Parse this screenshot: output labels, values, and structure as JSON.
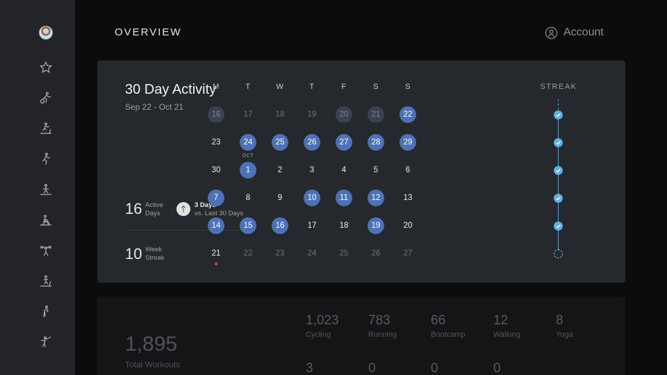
{
  "header": {
    "title": "OVERVIEW",
    "account_label": "Account"
  },
  "sidebar": {
    "items": [
      {
        "name": "avatar"
      },
      {
        "name": "star-icon"
      },
      {
        "name": "cycling-icon"
      },
      {
        "name": "treadmill-icon"
      },
      {
        "name": "running-icon"
      },
      {
        "name": "bootcamp-icon"
      },
      {
        "name": "rowing-icon"
      },
      {
        "name": "strength-icon"
      },
      {
        "name": "tread-bootcamp-icon"
      },
      {
        "name": "stretching-icon"
      },
      {
        "name": "yoga-icon"
      }
    ]
  },
  "activity": {
    "title": "30 Day Activity",
    "range": "Sep 22 - Oct 21",
    "active_days_value": "16",
    "active_days_label_1": "Active",
    "active_days_label_2": "Days",
    "trend_title": "3 Days",
    "trend_sub": "vs. Last 30 Days",
    "week_streak_value": "10",
    "week_streak_label_1": "Week",
    "week_streak_label_2": "Streak"
  },
  "calendar": {
    "day_headers": [
      "M",
      "T",
      "W",
      "T",
      "F",
      "S",
      "S"
    ],
    "streak_header": "STREAK",
    "month_tag": "OCT",
    "weeks": [
      [
        {
          "d": "16",
          "a": true,
          "m": true
        },
        {
          "d": "17",
          "a": false,
          "m": true
        },
        {
          "d": "18",
          "a": false,
          "m": true
        },
        {
          "d": "19",
          "a": false,
          "m": true
        },
        {
          "d": "20",
          "a": true,
          "m": true
        },
        {
          "d": "21",
          "a": true,
          "m": true
        },
        {
          "d": "22",
          "a": true,
          "m": false
        }
      ],
      [
        {
          "d": "23",
          "a": false,
          "m": false
        },
        {
          "d": "24",
          "a": true,
          "m": false
        },
        {
          "d": "25",
          "a": true,
          "m": false
        },
        {
          "d": "26",
          "a": true,
          "m": false
        },
        {
          "d": "27",
          "a": true,
          "m": false
        },
        {
          "d": "28",
          "a": true,
          "m": false
        },
        {
          "d": "29",
          "a": true,
          "m": false
        }
      ],
      [
        {
          "d": "30",
          "a": false,
          "m": false
        },
        {
          "d": "1",
          "a": true,
          "m": false
        },
        {
          "d": "2",
          "a": false,
          "m": false
        },
        {
          "d": "3",
          "a": false,
          "m": false
        },
        {
          "d": "4",
          "a": false,
          "m": false
        },
        {
          "d": "5",
          "a": false,
          "m": false
        },
        {
          "d": "6",
          "a": false,
          "m": false
        }
      ],
      [
        {
          "d": "7",
          "a": true,
          "m": false
        },
        {
          "d": "8",
          "a": false,
          "m": false
        },
        {
          "d": "9",
          "a": false,
          "m": false
        },
        {
          "d": "10",
          "a": true,
          "m": false
        },
        {
          "d": "11",
          "a": true,
          "m": false
        },
        {
          "d": "12",
          "a": true,
          "m": false
        },
        {
          "d": "13",
          "a": false,
          "m": false
        }
      ],
      [
        {
          "d": "14",
          "a": true,
          "m": false
        },
        {
          "d": "15",
          "a": true,
          "m": false
        },
        {
          "d": "16",
          "a": true,
          "m": false
        },
        {
          "d": "17",
          "a": false,
          "m": false
        },
        {
          "d": "18",
          "a": false,
          "m": false
        },
        {
          "d": "19",
          "a": true,
          "m": false
        },
        {
          "d": "20",
          "a": false,
          "m": false
        }
      ],
      [
        {
          "d": "21",
          "a": false,
          "m": false
        },
        {
          "d": "22",
          "a": false,
          "m": true
        },
        {
          "d": "23",
          "a": false,
          "m": true
        },
        {
          "d": "24",
          "a": false,
          "m": true
        },
        {
          "d": "25",
          "a": false,
          "m": true
        },
        {
          "d": "26",
          "a": false,
          "m": true
        },
        {
          "d": "27",
          "a": false,
          "m": true
        }
      ]
    ],
    "streak_weeks": [
      true,
      true,
      true,
      true,
      true,
      false
    ],
    "colors": {
      "active": "#4d72b5",
      "streak": "#61aee0",
      "today": "#e2455a"
    }
  },
  "totals": {
    "total_value": "1,895",
    "total_label": "Total Workouts",
    "by_type": [
      {
        "value": "1,023",
        "label": "Cycling"
      },
      {
        "value": "783",
        "label": "Running"
      },
      {
        "value": "66",
        "label": "Bootcamp"
      },
      {
        "value": "12",
        "label": "Walking"
      },
      {
        "value": "8",
        "label": "Yoga"
      },
      {
        "value": "3",
        "label": ""
      },
      {
        "value": "0",
        "label": ""
      },
      {
        "value": "0",
        "label": ""
      },
      {
        "value": "0",
        "label": ""
      }
    ]
  }
}
